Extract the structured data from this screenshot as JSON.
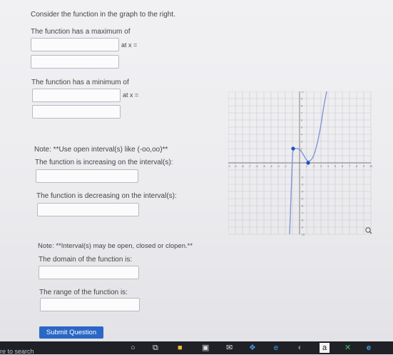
{
  "question": {
    "intro": "Consider the function in the graph to the right.",
    "max_label": "The function has a maximum of",
    "min_label": "The function has a minimum of",
    "at_x_label": "at x =",
    "note1": "Note: **Use open interval(s) like (-oo,oo)**",
    "increasing_label": "The function is increasing on the interval(s):",
    "decreasing_label": "The function is decreasing on the interval(s):",
    "note2": "Note: **Interval(s) may be open, closed or clopen.**",
    "domain_label": "The domain of the function is:",
    "range_label": "The range of the function is:",
    "submit_label": "Submit Question"
  },
  "inputs": {
    "max_value": "",
    "max_x": "",
    "min_value": "",
    "min_x": "",
    "increasing": "",
    "decreasing": "",
    "domain": "",
    "range": ""
  },
  "chart_data": {
    "type": "line",
    "xlim": [
      -10,
      10
    ],
    "ylim": [
      -10,
      10
    ],
    "grid": true,
    "x_tick_labels": [
      "-10",
      "-9",
      "-8",
      "-7",
      "-6",
      "-5",
      "-4",
      "-3",
      "-2",
      "1",
      "2",
      "3",
      "4",
      "5",
      "6",
      "7",
      "8",
      "9",
      "10"
    ],
    "y_tick_labels": [
      "10",
      "9",
      "8",
      "7",
      "6",
      "5",
      "4",
      "3",
      "2",
      "-2",
      "-3",
      "-4",
      "-5",
      "-6",
      "-7",
      "-8",
      "-9",
      "-10"
    ],
    "curve_points": [
      [
        -1.4,
        -10
      ],
      [
        -1.2,
        -5
      ],
      [
        -1,
        1
      ],
      [
        -0.9,
        2
      ],
      [
        0,
        2
      ],
      [
        0.5,
        1.2
      ],
      [
        1.2,
        0
      ],
      [
        2,
        0.8
      ],
      [
        2.8,
        4
      ],
      [
        3.4,
        8
      ],
      [
        3.8,
        10
      ]
    ],
    "marked_points": [
      [
        -0.9,
        2
      ],
      [
        1.2,
        0
      ]
    ],
    "colors": {
      "curve": "#7a8fd6",
      "point": "#1f4fc2",
      "grid": "#c9c9cf",
      "axis": "#777777"
    }
  },
  "taskbar": {
    "search_hint": "re to search",
    "icons": [
      "search-icon",
      "task-view-icon",
      "file-explorer-icon",
      "store-icon",
      "mail-icon",
      "dropbox-icon",
      "edge-icon",
      "app-icon",
      "amazon-icon",
      "app2-icon",
      "ie-icon"
    ]
  }
}
